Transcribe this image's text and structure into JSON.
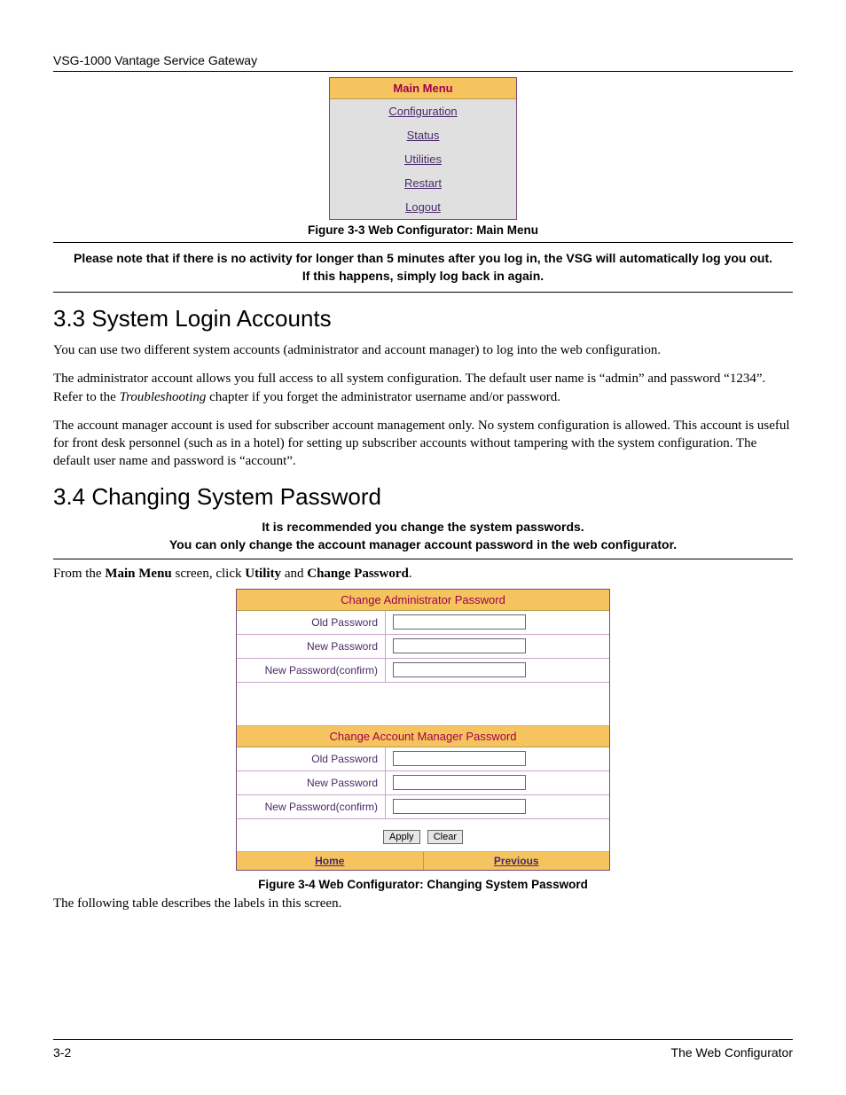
{
  "header": {
    "product": "VSG-1000 Vantage Service Gateway"
  },
  "figure33": {
    "menu_title": "Main Menu",
    "items": [
      "Configuration",
      "Status",
      "Utilities",
      "Restart",
      "Logout"
    ],
    "caption": "Figure 3-3 Web Configurator: Main Menu"
  },
  "note1": "Please note that if there is no activity for longer than 5 minutes after you log in, the VSG will automatically log you out. If this happens, simply log back in again.",
  "section33": {
    "heading": "3.3  System Login Accounts",
    "p1": "You can use two different system accounts (administrator and account manager) to log into the web configuration.",
    "p2a": "The administrator account allows you full access to all system configuration. The default user name is “admin” and password “1234”. Refer to the ",
    "p2_i": "Troubleshooting",
    "p2b": " chapter if you forget the administrator username and/or password.",
    "p3": "The account manager account is used for subscriber account management only.  No system configuration is allowed. This account is useful for front desk personnel (such as in a hotel) for setting up subscriber accounts without tampering with the system configuration. The default user name and password is “account”."
  },
  "section34": {
    "heading": "3.4  Changing System Password",
    "rec1": "It is recommended you change the system passwords.",
    "rec2": "You can only change the account manager account password in the web configurator.",
    "instr_pre": "From the ",
    "instr_b1": "Main Menu",
    "instr_mid1": " screen, click ",
    "instr_b2": "Utility",
    "instr_mid2": " and ",
    "instr_b3": "Change Password",
    "instr_post": "."
  },
  "figure34": {
    "panel1_title": "Change Administrator Password",
    "panel2_title": "Change Account Manager Password",
    "labels": {
      "old": "Old Password",
      "new": "New Password",
      "confirm": "New Password(confirm)"
    },
    "buttons": {
      "apply": "Apply",
      "clear": "Clear"
    },
    "nav": {
      "home": "Home",
      "previous": "Previous"
    },
    "caption": "Figure 3-4 Web Configurator: Changing System Password"
  },
  "after": "The following table describes the labels in this screen.",
  "footer": {
    "left": "3-2",
    "right": "The Web Configurator"
  }
}
